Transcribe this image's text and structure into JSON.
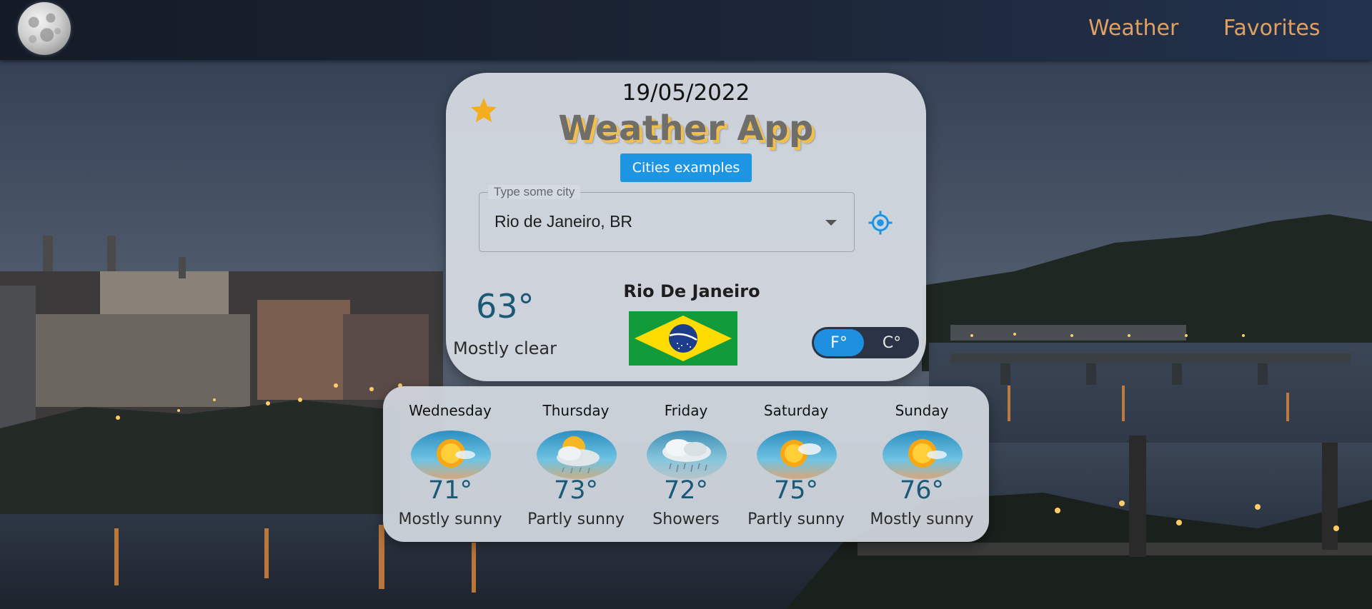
{
  "nav": {
    "links": [
      "Weather",
      "Favorites"
    ]
  },
  "card": {
    "date": "19/05/2022",
    "title": "Weather App",
    "cities_button": "Cities examples",
    "city_field": {
      "label": "Type some city",
      "value": "Rio de Janeiro, BR"
    },
    "current": {
      "temp": "63°",
      "condition": "Mostly clear",
      "city": "Rio De Janeiro"
    },
    "units": {
      "fahrenheit": "F°",
      "celsius": "C°",
      "selected": "F°"
    }
  },
  "forecast": [
    {
      "day": "Wednesday",
      "temp": "71°",
      "condition": "Mostly sunny",
      "icon": "sun-icon"
    },
    {
      "day": "Thursday",
      "temp": "73°",
      "condition": "Partly sunny",
      "icon": "sun-rain-icon"
    },
    {
      "day": "Friday",
      "temp": "72°",
      "condition": "Showers",
      "icon": "showers-icon"
    },
    {
      "day": "Saturday",
      "temp": "75°",
      "condition": "Partly sunny",
      "icon": "partly-sunny-icon"
    },
    {
      "day": "Sunday",
      "temp": "76°",
      "condition": "Mostly sunny",
      "icon": "sun-icon"
    }
  ],
  "colors": {
    "accent_blue": "#1e95e3",
    "nav_link": "#e0a062",
    "title_shadow": "#f2c04a",
    "temp_text": "#1a5a78"
  }
}
